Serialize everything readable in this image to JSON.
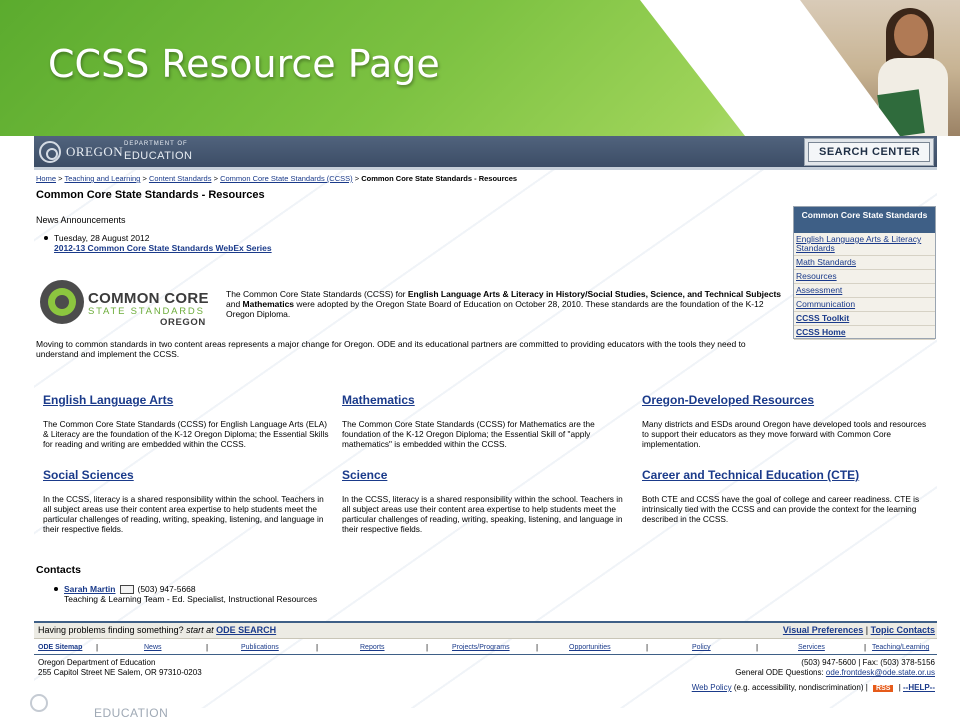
{
  "slide": {
    "title": "CCSS Resource Page",
    "footer_text": "EDUCATION"
  },
  "header": {
    "logo_state": "OREGON",
    "logo_dept": "DEPARTMENT OF",
    "logo_edu": "EDUCATION",
    "search_center": "SEARCH CENTER"
  },
  "breadcrumb": {
    "items": [
      "Home",
      "Teaching and Learning",
      "Content Standards",
      "Common Core State Standards (CCSS)"
    ],
    "current": "Common Core State Standards - Resources",
    "sep": ">"
  },
  "page": {
    "title": "Common Core State Standards - Resources",
    "news_heading": "News Announcements",
    "news_date": "Tuesday, 28 August 2012",
    "news_link": "2012-13 Common Core State Standards WebEx Series"
  },
  "sidebar": {
    "heading": "Common Core State Standards",
    "links": [
      "English Language Arts & Literacy Standards",
      "Math Standards",
      "Resources",
      "Assessment",
      "Communication",
      "CCSS Toolkit",
      "CCSS Home"
    ]
  },
  "ccss_logo": {
    "line1": "COMMON CORE",
    "line2": "STATE STANDARDS",
    "line3": "OREGON"
  },
  "intro": {
    "p1_a": "The Common Core State Standards (CCSS) for ",
    "p1_b": "English Language Arts & Literacy in History/Social Studies, Science, and Technical Subjects",
    "p1_c": " and ",
    "p1_d": "Mathematics",
    "p1_e": " were adopted by the Oregon State Board of Education on October 28, 2010. These standards are the foundation of the K-12 Oregon Diploma.",
    "p2": "Moving to common standards in two content areas represents a major change for Oregon. ODE and its educational partners are committed to providing educators with the tools they need to understand and implement the CCSS."
  },
  "cards": [
    {
      "title": "English Language Arts",
      "body": "The Common Core State Standards (CCSS) for English Language Arts (ELA) & Literacy are the foundation of the K-12 Oregon Diploma; the Essential Skills for reading and writing are embedded within the CCSS."
    },
    {
      "title": "Mathematics",
      "body": "The Common Core State Standards (CCSS) for Mathematics are the foundation of the K-12 Oregon Diploma; the Essential Skill of \"apply mathematics\" is embedded within the CCSS."
    },
    {
      "title": "Oregon-Developed Resources",
      "body": "Many districts and ESDs around Oregon have developed tools and resources to support their educators as they move forward with Common Core implementation."
    },
    {
      "title": "Social Sciences",
      "body": "In the CCSS, literacy is a shared responsibility within the school. Teachers in all subject areas use their content area expertise to help students meet the particular challenges of reading, writing, speaking, listening, and language in their respective fields."
    },
    {
      "title": "Science",
      "body": "In the CCSS, literacy is a shared responsibility within the school. Teachers in all subject areas use their content area expertise to help students meet the particular challenges of reading, writing, speaking, listening, and language in their respective fields."
    },
    {
      "title": "Career and Technical Education (CTE)",
      "body": "Both CTE and CCSS have the goal of college and career readiness. CTE is intrinsically tied with the CCSS and can provide the context for the learning described in the CCSS."
    }
  ],
  "contacts": {
    "heading": "Contacts",
    "name": "Sarah Martin",
    "phone": "(503) 947-5668",
    "role": "Teaching & Learning Team - Ed. Specialist, Instructional Resources"
  },
  "help_bar": {
    "text": "Having problems finding something?",
    "start": "start at",
    "link": "ODE SEARCH",
    "visual": "Visual Preferences",
    "sep": "|",
    "topic": "Topic Contacts"
  },
  "footer": {
    "links": [
      "ODE Sitemap",
      "News",
      "Publications",
      "Reports",
      "Projects/Programs",
      "Opportunities",
      "Policy",
      "Services",
      "Teaching/Learning"
    ],
    "sep": "|",
    "org": "Oregon Department of Education",
    "address": "255 Capitol Street NE   Salem, OR 97310-0203",
    "phone_fax": "(503) 947-5600  |  Fax: (503) 378-5156",
    "questions": "General ODE Questions:",
    "email": "ode.frontdesk@ode.state.or.us",
    "policy_link": "Web Policy",
    "policy_note": "(e.g. accessibility, nondiscrimination)",
    "rss": "RSS",
    "help": "--HELP--"
  }
}
